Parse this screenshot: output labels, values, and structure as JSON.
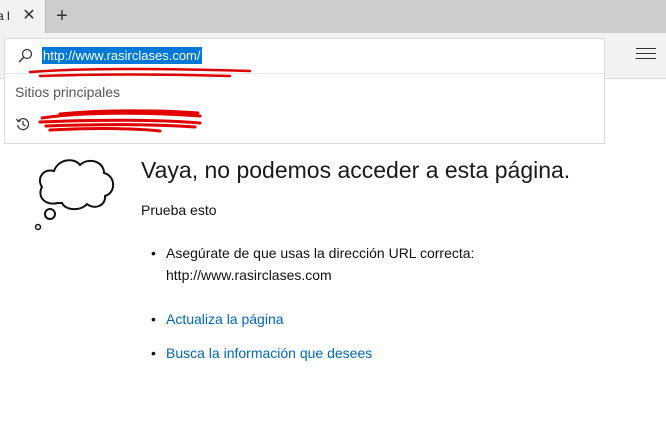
{
  "browser": {
    "tab": {
      "title": "a l",
      "close_glyph": "✕"
    },
    "new_tab_glyph": "+",
    "address": {
      "value": "http://www.rasirclases.com/"
    },
    "dropdown": {
      "section_title": "Sitios principales"
    },
    "icons": [
      "search-icon",
      "history-icon",
      "menu-icon",
      "close-icon",
      "plus-icon"
    ]
  },
  "error": {
    "title": "Vaya, no podemos acceder a esta página.",
    "try_label": "Prueba esto",
    "suggestions": [
      {
        "text": "Asegúrate de que usas la dirección URL correcta:",
        "url": "http://www.rasirclases.com"
      },
      {
        "text": "Actualiza la página"
      },
      {
        "text": "Busca la información que desees"
      }
    ]
  },
  "colors": {
    "link": "#0067b8",
    "selection": "#0078d7",
    "redaction": "#e00000"
  }
}
